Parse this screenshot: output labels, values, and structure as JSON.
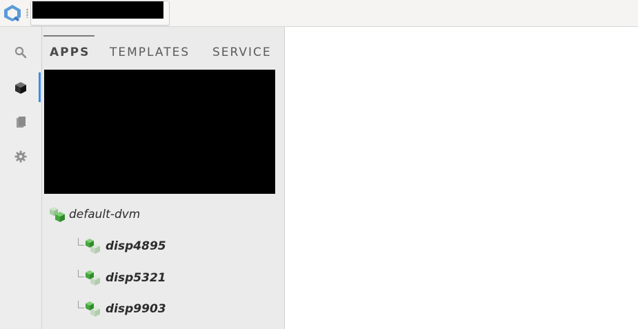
{
  "app": {
    "logo_icon": "qubes-q-logo-icon",
    "search": {
      "value": "",
      "placeholder": ""
    }
  },
  "sidebar": {
    "items": [
      {
        "name": "search",
        "icon": "search-icon"
      },
      {
        "name": "apps",
        "icon": "cube-icon",
        "active": true
      },
      {
        "name": "bookmarks",
        "icon": "bookmark-icon"
      },
      {
        "name": "settings",
        "icon": "gear-icon"
      }
    ],
    "accent": "#3c8ce7"
  },
  "tabs": [
    {
      "label": "APPS",
      "active": true
    },
    {
      "label": "TEMPLATES",
      "active": false
    },
    {
      "label": "SERVICE",
      "active": false
    }
  ],
  "tree": {
    "root": {
      "label": "default-dvm",
      "icon": "dvm-template-cube-icon"
    },
    "children": [
      {
        "label": "disp4895",
        "icon": "dispvm-cube-icon"
      },
      {
        "label": "disp5321",
        "icon": "dispvm-cube-icon"
      },
      {
        "label": "disp9903",
        "icon": "dispvm-cube-icon"
      }
    ],
    "colors": {
      "qube_green": "#46a640",
      "qube_light": "#a9cfa4"
    }
  }
}
